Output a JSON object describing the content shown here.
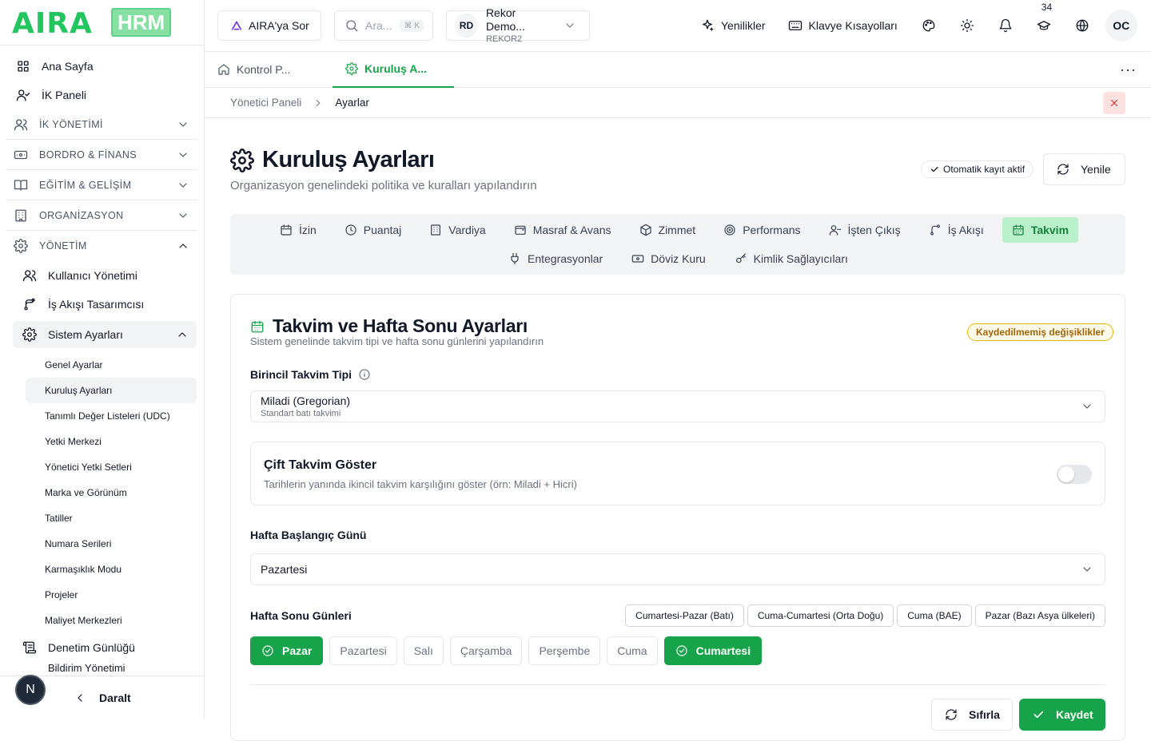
{
  "brand": {
    "name": "AIRA",
    "product": "HRM",
    "color": "#22c55e"
  },
  "sidebar": {
    "top_items": [
      {
        "label": "Ana Sayfa",
        "icon": "grid-icon"
      },
      {
        "label": "İK Paneli",
        "icon": "user-check-icon"
      }
    ],
    "sections": [
      {
        "label": "İK YÖNETİMİ",
        "icon": "users-icon",
        "expanded": false
      },
      {
        "label": "BORDRO & FİNANS",
        "icon": "banknote-icon",
        "expanded": false
      },
      {
        "label": "EĞİTİM & GELİŞİM",
        "icon": "book-icon",
        "expanded": false
      },
      {
        "label": "ORGANİZASYON",
        "icon": "building-icon",
        "expanded": false
      },
      {
        "label": "YÖNETİM",
        "icon": "gear-icon",
        "expanded": true
      }
    ],
    "admin_items": [
      {
        "label": "Kullanıcı Yönetimi",
        "icon": "users-icon"
      },
      {
        "label": "İş Akışı Tasarımcısı",
        "icon": "workflow-icon"
      }
    ],
    "active_group": {
      "label": "Sistem Ayarları",
      "icon": "gear-icon"
    },
    "leaves": [
      "Genel Ayarlar",
      "Kuruluş Ayarları",
      "Tanımlı Değer Listeleri (UDC)",
      "Yetki Merkezi",
      "Yönetici Yetki Setleri",
      "Marka ve Görünüm",
      "Tatiller",
      "Numara Serileri",
      "Karmaşıklık Modu",
      "Projeler",
      "Maliyet Merkezleri"
    ],
    "selected_leaf": "Kuruluş Ayarları",
    "audit": {
      "label": "Denetim Günlüğü",
      "icon": "scroll-icon"
    },
    "partial_item": "Bildirim Yönetimi",
    "collapse_label": "Daralt",
    "bubble": "N"
  },
  "header": {
    "ask_label": "AIRA'ya Sor",
    "search_placeholder": "Ara...",
    "shortcut": "⌘ K",
    "company": {
      "initials": "RD",
      "name": "Rekor Demo...",
      "code": "REKOR2"
    },
    "whats_new": "Yenilikler",
    "shortcuts": "Klavye Kısayolları",
    "badge_count": "34",
    "avatar": "OC"
  },
  "page_tabs": [
    {
      "label": "Kontrol P...",
      "icon": "home-icon",
      "active": false
    },
    {
      "label": "Kuruluş A...",
      "icon": "gear-icon",
      "active": true
    }
  ],
  "breadcrumb": [
    "Yönetici Paneli",
    "Ayarlar"
  ],
  "page": {
    "title": "Kuruluş Ayarları",
    "subtitle": "Organizasyon genelindeki politika ve kuralları yapılandırın",
    "autosave": "Otomatik kayıt aktif",
    "refresh": "Yenile"
  },
  "settings_tabs_row1": [
    {
      "label": "İzin",
      "icon": "calendar-icon"
    },
    {
      "label": "Puantaj",
      "icon": "clock-icon"
    },
    {
      "label": "Vardiya",
      "icon": "building-icon"
    },
    {
      "label": "Masraf & Avans",
      "icon": "wallet-icon"
    },
    {
      "label": "Zimmet",
      "icon": "package-icon"
    },
    {
      "label": "Performans",
      "icon": "target-icon"
    },
    {
      "label": "İşten Çıkış",
      "icon": "user-minus-icon"
    },
    {
      "label": "İş Akışı",
      "icon": "workflow-icon"
    },
    {
      "label": "Takvim",
      "icon": "calendar-icon",
      "active": true
    }
  ],
  "settings_tabs_row2": [
    {
      "label": "Entegrasyonlar",
      "icon": "plug-icon"
    },
    {
      "label": "Döviz Kuru",
      "icon": "banknote-icon"
    },
    {
      "label": "Kimlik Sağlayıcıları",
      "icon": "key-icon"
    }
  ],
  "calendar": {
    "title": "Takvim ve Hafta Sonu Ayarları",
    "subtitle": "Sistem genelinde takvim tipi ve hafta sonu günlerini yapılandırın",
    "unsaved": "Kaydedilmemiş değişiklikler",
    "primary_label": "Birincil Takvim Tipi",
    "primary_value": "Miladi (Gregorian)",
    "primary_desc": "Standart batı takvimi",
    "dual_title": "Çift Takvim Göster",
    "dual_desc": "Tarihlerin yanında ikincil takvim karşılığını göster (örn: Miladi + Hicri)",
    "dual_enabled": false,
    "week_start_label": "Hafta Başlangıç Günü",
    "week_start_value": "Pazartesi",
    "weekend_label": "Hafta Sonu Günleri",
    "presets": [
      "Cumartesi-Pazar (Batı)",
      "Cuma-Cumartesi (Orta Doğu)",
      "Cuma (BAE)",
      "Pazar (Bazı Asya ülkeleri)"
    ],
    "days": [
      {
        "label": "Pazar",
        "selected": true
      },
      {
        "label": "Pazartesi",
        "selected": false
      },
      {
        "label": "Salı",
        "selected": false
      },
      {
        "label": "Çarşamba",
        "selected": false
      },
      {
        "label": "Perşembe",
        "selected": false
      },
      {
        "label": "Cuma",
        "selected": false
      },
      {
        "label": "Cumartesi",
        "selected": true
      }
    ],
    "reset": "Sıfırla",
    "save": "Kaydet"
  }
}
